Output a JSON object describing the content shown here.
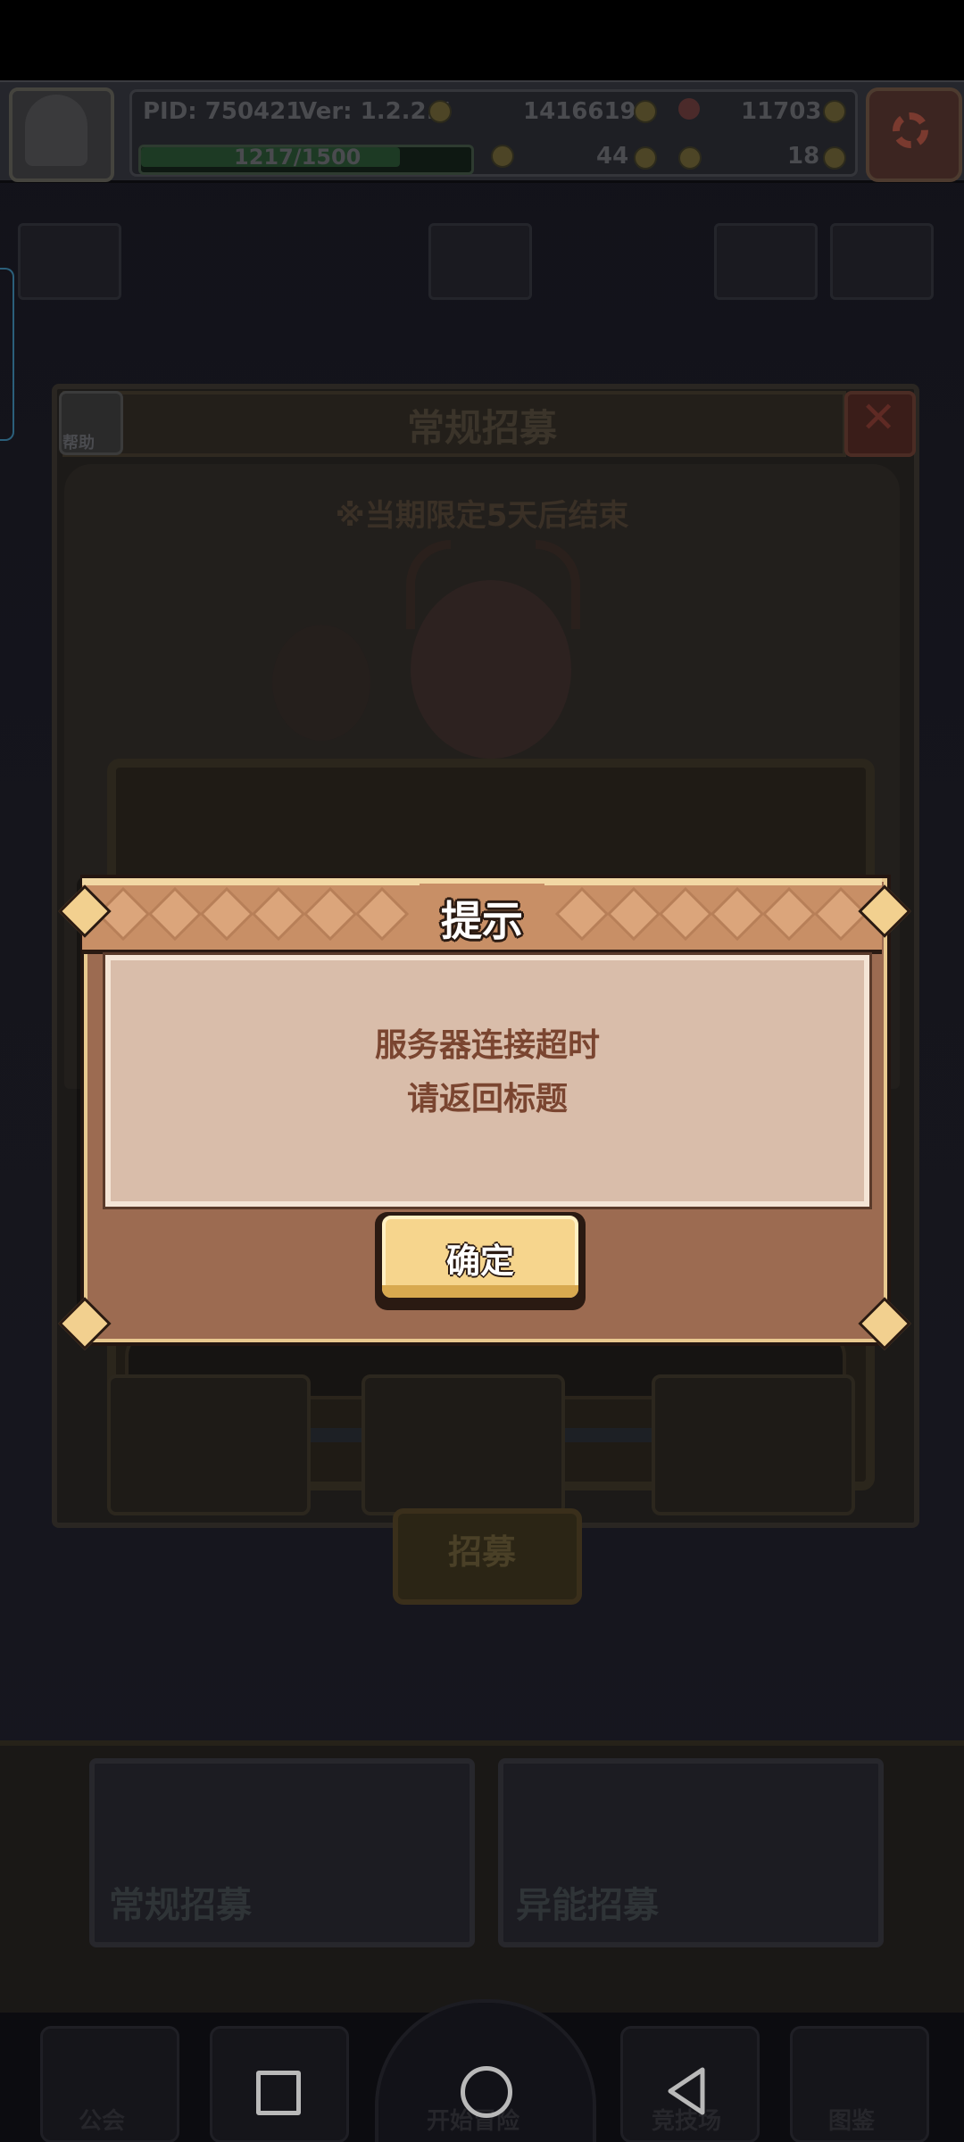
{
  "topbar": {
    "pid_text": "PID: 750421",
    "version_text": "Ver: 1.2.2.5",
    "gold": "1416619",
    "gems": "11703",
    "exp": "1217/1500",
    "stamina": "44",
    "keys": "18"
  },
  "recruit": {
    "title": "常规招募",
    "help_label": "帮助",
    "notice": "※当期限定5天后结束",
    "recruit_button": "招募"
  },
  "bottom_cards": [
    "常规招募",
    "异能招募"
  ],
  "bottom_nav": [
    "公会",
    "开始冒险",
    "竞技场",
    "图鉴"
  ],
  "dialog": {
    "title": "提示",
    "message_line1": "服务器连接超时",
    "message_line2": "请返回标题",
    "confirm_label": "确定"
  },
  "colors": {
    "dialog_brown": "#9c6b51",
    "dialog_body": "#d9bdaa",
    "button_yellow": "#f6d58d",
    "message_text": "#7a4530"
  }
}
